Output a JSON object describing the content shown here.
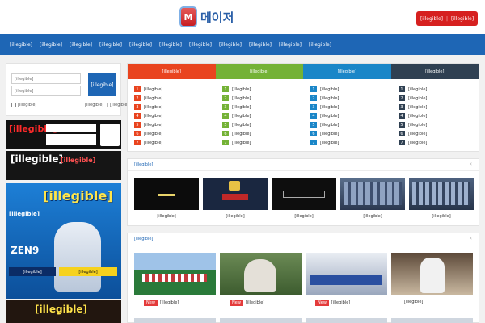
{
  "header": {
    "logo_text": "메이저",
    "logo_badge": "M",
    "auth": {
      "login": "[illegible]",
      "join": "[illegible]"
    }
  },
  "nav": [
    "[illegible]",
    "[illegible]",
    "[illegible]",
    "[illegible]",
    "[illegible]",
    "[illegible]",
    "[illegible]",
    "[illegible]",
    "[illegible]",
    "[illegible]",
    "[illegible]"
  ],
  "login": {
    "id_placeholder": "[illegible]",
    "pw_placeholder": "[illegible]",
    "button": "[illegible]",
    "remember": "[illegible]",
    "link_find": "[illegible]",
    "link_join": "[illegible]"
  },
  "banners": {
    "b1": {
      "text": "[illegible]",
      "side": "[illegible]"
    },
    "b2": {
      "text": "[illegible]",
      "text2": "[illegible]"
    },
    "b3": {
      "headline": "[illegible]",
      "line": "[illegible]",
      "brand": "ZEN9",
      "code": "[illegible]",
      "code2": "[illegible]"
    },
    "b4": {
      "text": "[illegible]"
    }
  },
  "board": {
    "tabs": [
      {
        "label": "[illegible]",
        "color": "#e9441f"
      },
      {
        "label": "[illegible]",
        "color": "#74b236"
      },
      {
        "label": "[illegible]",
        "color": "#1a86c8"
      },
      {
        "label": "[illegible]",
        "color": "#2f4052"
      }
    ],
    "columns": [
      {
        "color": "#e9441f",
        "items": [
          "[illegible]",
          "[illegible]",
          "[illegible]",
          "[illegible]",
          "[illegible]",
          "[illegible]",
          "[illegible]"
        ]
      },
      {
        "color": "#74b236",
        "items": [
          "[illegible]",
          "[illegible]",
          "[illegible]",
          "[illegible]",
          "[illegible]",
          "[illegible]",
          "[illegible]"
        ]
      },
      {
        "color": "#1a86c8",
        "items": [
          "[illegible]",
          "[illegible]",
          "[illegible]",
          "[illegible]",
          "[illegible]",
          "[illegible]",
          "[illegible]"
        ]
      },
      {
        "color": "#2f4052",
        "items": [
          "[illegible]",
          "[illegible]",
          "[illegible]",
          "[illegible]",
          "[illegible]",
          "[illegible]",
          "[illegible]"
        ]
      }
    ]
  },
  "section1": {
    "title": "[illegible]",
    "items": [
      {
        "caption": "[illegible]"
      },
      {
        "caption": "[illegible]"
      },
      {
        "caption": "[illegible]"
      },
      {
        "caption": "[illegible]"
      },
      {
        "caption": "[illegible]"
      }
    ]
  },
  "section2": {
    "title": "[illegible]",
    "items": [
      {
        "badge": "New",
        "caption": "[illegible]",
        "meta": ""
      },
      {
        "badge": "New",
        "caption": "[illegible]",
        "meta": ""
      },
      {
        "badge": "New",
        "caption": "[illegible]",
        "meta": ""
      },
      {
        "badge": "",
        "caption": "[illegible]",
        "meta": ""
      }
    ]
  },
  "colors": {
    "brand": "#1e66b5",
    "accent": "#d6201f"
  }
}
